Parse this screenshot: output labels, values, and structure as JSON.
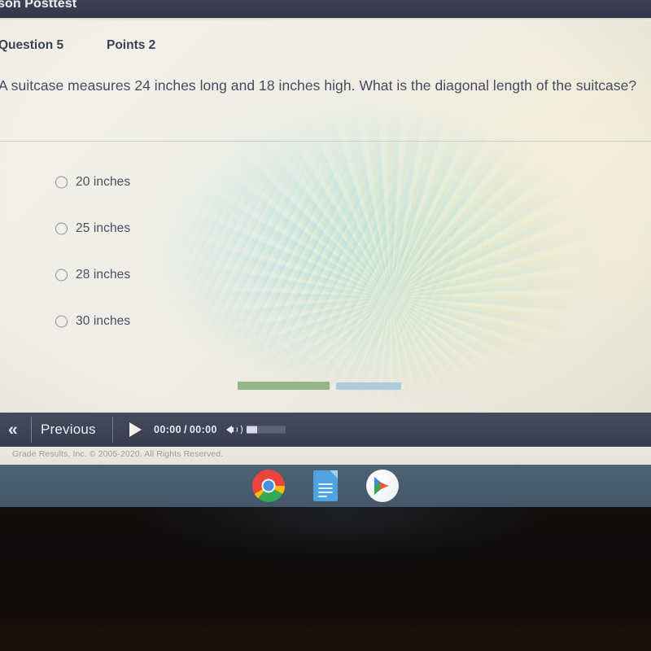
{
  "titlebar": {
    "title": "son Posttest"
  },
  "question": {
    "number_label": "Question 5",
    "points_label": "Points 2",
    "text": "A suitcase measures 24 inches long and 18 inches high. What is the diagonal length of the suitcase?",
    "options": [
      {
        "label": "20 inches",
        "selected": false
      },
      {
        "label": "25 inches",
        "selected": false
      },
      {
        "label": "28 inches",
        "selected": false
      },
      {
        "label": "30 inches",
        "selected": false
      }
    ]
  },
  "toolbar": {
    "previous_chevron": "«",
    "previous_label": "Previous",
    "current_time": "00:00",
    "separator": "/",
    "total_time": "00:00",
    "volume_percent": 27
  },
  "footer": {
    "copyright": "Grade Results, Inc. © 2005-2020. All Rights Reserved."
  },
  "taskbar": {
    "apps": [
      {
        "name": "Chrome",
        "active": true
      },
      {
        "name": "Docs",
        "active": false
      },
      {
        "name": "Play Store",
        "active": false
      }
    ]
  },
  "colors": {
    "titlebar_bg": "#393c4e",
    "panel_bg": "#efeee6",
    "text_primary": "#474b61",
    "toolbar_bg": "#3f4356",
    "taskbar_bg": "#495d6e",
    "footer_text": "#9a9b9c",
    "accent_green": "#8fb282",
    "accent_blue": "#a6c9dd"
  }
}
